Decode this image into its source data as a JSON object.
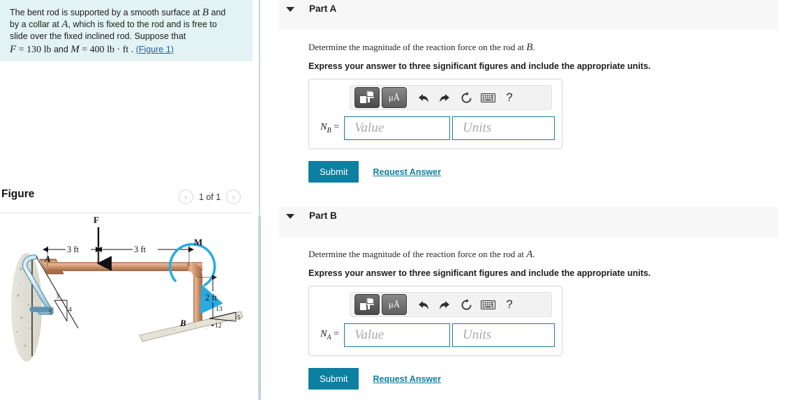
{
  "problem": {
    "line1": "The bent rod is supported by a smooth surface at ",
    "var_B": "B",
    "line1b": " and",
    "line2a": "by a collar at ",
    "var_A": "A",
    "line2b": ", which is fixed to the rod and is free to",
    "line3": "slide over the fixed inclined rod. Suppose that",
    "f_symbol": "F",
    "f_eq": " = 130",
    "f_units": "lb",
    "and": "and",
    "m_symbol": "M",
    "m_eq": " = 400",
    "m_units": "lb · ft",
    "period": ".",
    "figure_link": "(Figure 1)"
  },
  "figure": {
    "title": "Figure",
    "counter": "1 of 1",
    "prev_icon": "chevron-left-icon",
    "next_icon": "chevron-right-icon",
    "prev_glyph": "‹",
    "next_glyph": "›",
    "labels": {
      "force": "F",
      "moment": "M",
      "point_a": "A",
      "point_b": "B",
      "dim_left": "3 ft",
      "dim_right": "3 ft",
      "dim_vertical": "2 ft",
      "slope_a_3": "3",
      "slope_a_4": "4",
      "slope_a_5": "5",
      "slope_b_13": "13",
      "slope_b_12": "12",
      "slope_b_5": "5"
    }
  },
  "parts": [
    {
      "id": "part-a",
      "title": "Part A",
      "caret_icon": "caret-down-icon",
      "question_pre": "Determine the magnitude of the reaction force on the rod at ",
      "question_var": "B",
      "question_post": ".",
      "instruction": "Express your answer to three significant figures and include the appropriate units.",
      "answer_label_var": "N",
      "answer_label_sub": "B",
      "answer_label_eq": " =",
      "value_placeholder": "Value",
      "units_placeholder": "Units",
      "value": "",
      "units": "",
      "submit_label": "Submit",
      "request_label": "Request Answer",
      "toolbar": {
        "template_icon": "math-template-icon",
        "units_icon": "greek-units-icon",
        "units_label": "μÅ",
        "undo_icon": "undo-icon",
        "redo_icon": "redo-icon",
        "reset_icon": "reset-icon",
        "keyboard_icon": "keyboard-icon",
        "help_icon": "help-icon",
        "help_glyph": "?"
      }
    },
    {
      "id": "part-b",
      "title": "Part B",
      "caret_icon": "caret-down-icon",
      "question_pre": "Determine the magnitude of the reaction force on the rod at ",
      "question_var": "A",
      "question_post": ".",
      "instruction": "Express your answer to three significant figures and include the appropriate units.",
      "answer_label_var": "N",
      "answer_label_sub": "A",
      "answer_label_eq": " =",
      "value_placeholder": "Value",
      "units_placeholder": "Units",
      "value": "",
      "units": "",
      "submit_label": "Submit",
      "request_label": "Request Answer",
      "toolbar": {
        "template_icon": "math-template-icon",
        "units_icon": "greek-units-icon",
        "units_label": "μÅ",
        "undo_icon": "undo-icon",
        "redo_icon": "redo-icon",
        "reset_icon": "reset-icon",
        "keyboard_icon": "keyboard-icon",
        "help_icon": "help-icon",
        "help_glyph": "?"
      }
    }
  ],
  "colors": {
    "statement_bg": "#e3f3f3",
    "accent_teal": "#0d7fa0",
    "input_border": "#1c7a99",
    "header_bg": "#f7f7f7",
    "rod_copper": "#c98b63",
    "rod_blue": "#9ccbe0",
    "moment_arrow": "#29abe2"
  }
}
